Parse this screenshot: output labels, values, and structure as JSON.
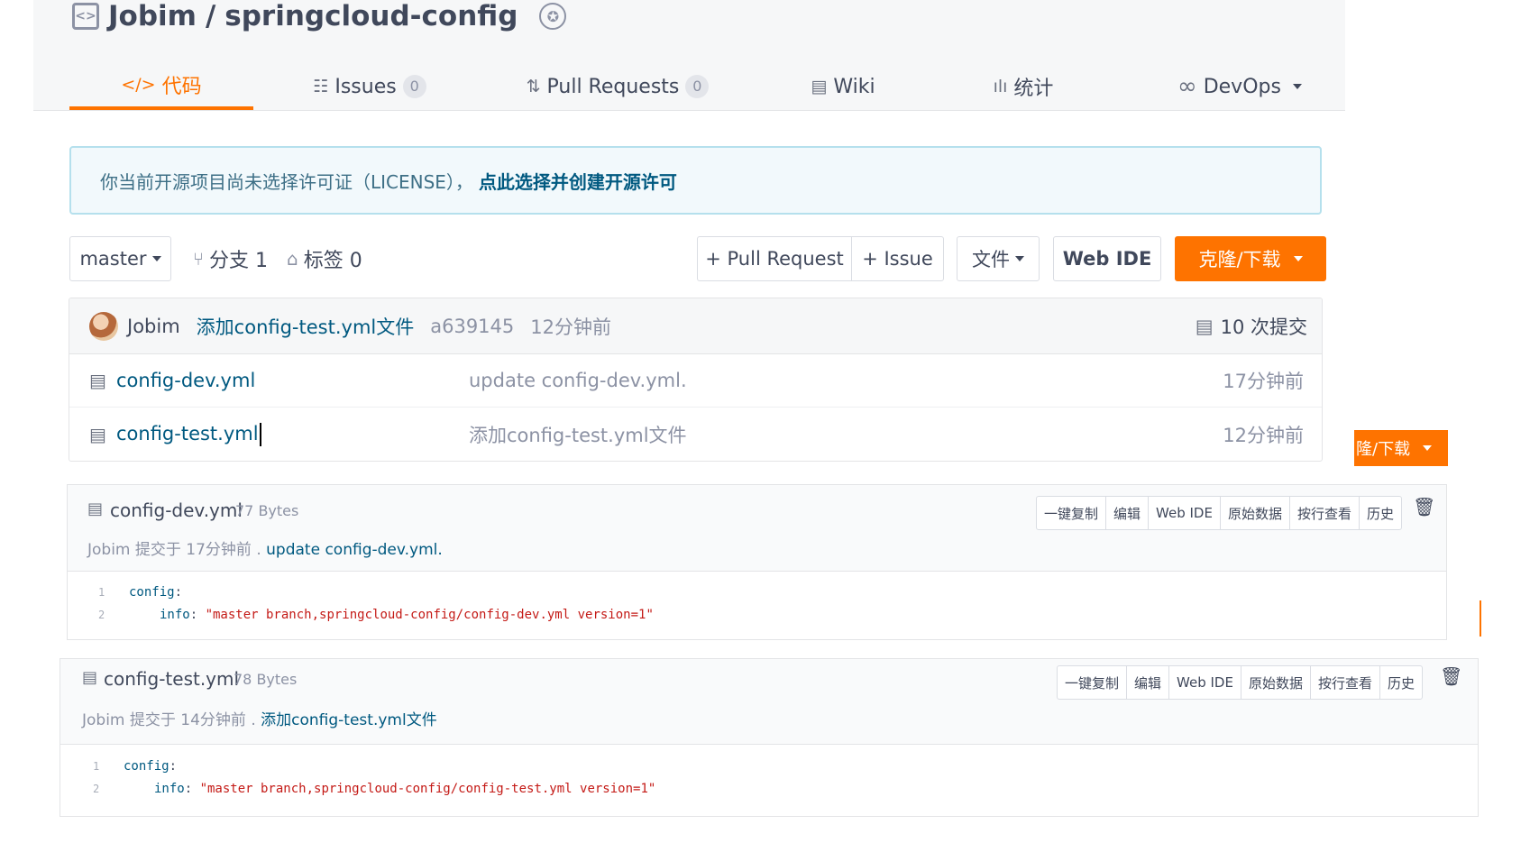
{
  "repo": {
    "owner": "Jobim",
    "separator": "/",
    "name": "springcloud-config"
  },
  "nav": {
    "code": {
      "icon": "</>",
      "label": "代码"
    },
    "issues": {
      "icon": "☷",
      "label": "Issues",
      "count": "0"
    },
    "pulls": {
      "icon": "⇅",
      "label": "Pull Requests",
      "count": "0"
    },
    "wiki": {
      "icon": "▤",
      "label": "Wiki"
    },
    "stats": {
      "icon": "ılı",
      "label": "统计"
    },
    "devops": {
      "icon": "∞",
      "label": "DevOps"
    }
  },
  "license": {
    "text": "你当前开源项目尚未选择许可证（LICENSE），",
    "link": "点此选择并创建开源许可"
  },
  "toolbar": {
    "branch": "master",
    "branches_label": "分支 1",
    "tags_label": "标签 0",
    "pull_request": "+ Pull Request",
    "issue": "+ Issue",
    "file": "文件",
    "web_ide": "Web IDE",
    "clone": "克隆/下载",
    "clone_partial": "隆/下载"
  },
  "latest_commit": {
    "author": "Jobim",
    "message": "添加config-test.yml文件",
    "hash": "a639145",
    "time": "12分钟前",
    "commit_count": "10 次提交"
  },
  "files": [
    {
      "name": "config-dev.yml",
      "commit": "update config-dev.yml.",
      "time": "17分钟前"
    },
    {
      "name": "config-test.yml",
      "commit": "添加config-test.yml文件",
      "time": "12分钟前"
    }
  ],
  "actions": {
    "copy": "一键复制",
    "edit": "编辑",
    "web_ide": "Web IDE",
    "raw": "原始数据",
    "blame": "按行查看",
    "history": "历史"
  },
  "panels": [
    {
      "file": "config-dev.yml",
      "size": "77 Bytes",
      "commit_info": "Jobim 提交于 17分钟前 .",
      "commit_msg": "update config-dev.yml.",
      "lines": [
        {
          "no": "1",
          "key": "config",
          "sep": ":",
          "val": ""
        },
        {
          "no": "2",
          "key": "info",
          "sep": ": ",
          "val": "\"master branch,springcloud-config/config-dev.yml version=1\""
        }
      ]
    },
    {
      "file": "config-test.yml",
      "size": "78 Bytes",
      "commit_info": "Jobim 提交于 14分钟前 .",
      "commit_msg": "添加config-test.yml文件",
      "lines": [
        {
          "no": "1",
          "key": "config",
          "sep": ":",
          "val": ""
        },
        {
          "no": "2",
          "key": "info",
          "sep": ": ",
          "val": "\"master branch,springcloud-config/config-test.yml version=1\""
        }
      ]
    }
  ],
  "colors": {
    "accent": "#fe7300",
    "link": "#005980",
    "string": "#c41a16"
  }
}
